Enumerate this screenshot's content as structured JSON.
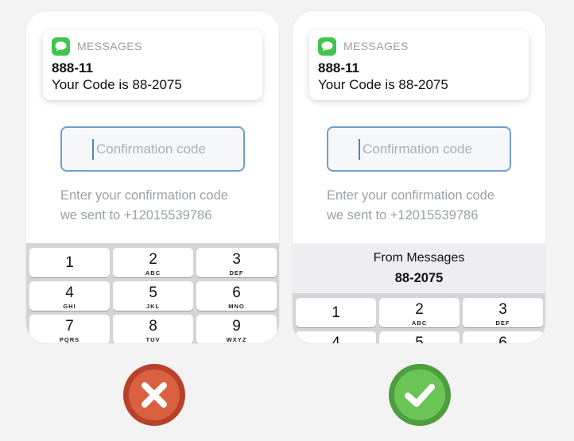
{
  "left_phone": {
    "notification": {
      "app_name": "MESSAGES",
      "sender": "888-11",
      "body": "Your Code is 88-2075"
    },
    "code_field": {
      "placeholder": "Confirmation code",
      "value": ""
    },
    "instruction": {
      "line1": "Enter your confirmation code",
      "line2": "we sent to +12015539786"
    },
    "keypad": [
      {
        "digit": "1",
        "letters": ""
      },
      {
        "digit": "2",
        "letters": "ABC"
      },
      {
        "digit": "3",
        "letters": "DEF"
      },
      {
        "digit": "4",
        "letters": "GHI"
      },
      {
        "digit": "5",
        "letters": "JKL"
      },
      {
        "digit": "6",
        "letters": "MNO"
      },
      {
        "digit": "7",
        "letters": "PQRS"
      },
      {
        "digit": "8",
        "letters": "TUV"
      },
      {
        "digit": "9",
        "letters": "WXYZ"
      }
    ]
  },
  "right_phone": {
    "notification": {
      "app_name": "MESSAGES",
      "sender": "888-11",
      "body": "Your Code is 88-2075"
    },
    "code_field": {
      "placeholder": "Confirmation code",
      "value": ""
    },
    "instruction": {
      "line1": "Enter your confirmation code",
      "line2": "we sent to +12015539786"
    },
    "autofill_suggestion": {
      "label": "From Messages",
      "code": "88-2075"
    },
    "keypad": [
      {
        "digit": "1",
        "letters": ""
      },
      {
        "digit": "2",
        "letters": "ABC"
      },
      {
        "digit": "3",
        "letters": "DEF"
      },
      {
        "digit": "4",
        "letters": ""
      },
      {
        "digit": "5",
        "letters": ""
      },
      {
        "digit": "6",
        "letters": ""
      }
    ]
  },
  "verdicts": {
    "left": {
      "icon": "x-icon",
      "color": "#d96040"
    },
    "right": {
      "icon": "checkmark-icon",
      "color": "#6bc456"
    }
  },
  "colors": {
    "messages_green": "#3ec44f",
    "field_border": "#6f9fcf",
    "page_bg": "#f3f3f3"
  }
}
